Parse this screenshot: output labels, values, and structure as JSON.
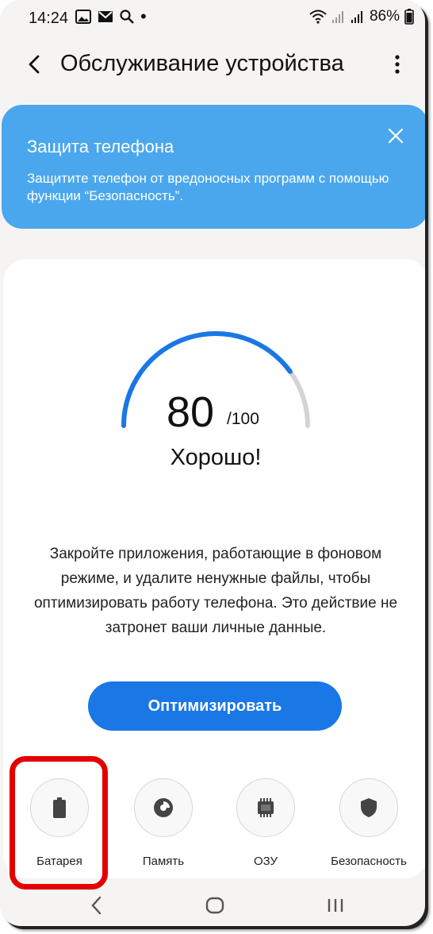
{
  "status_bar": {
    "time": "14:24",
    "battery": "86%"
  },
  "app_bar": {
    "title": "Обслуживание устройства"
  },
  "banner": {
    "title": "Защита телефона",
    "text": "Защитите телефон от вредоносных программ с помощью функции “Безопасность”."
  },
  "score": {
    "value": "80",
    "max": "/100",
    "fraction": 0.8,
    "status": "Хорошо!"
  },
  "description": "Закройте приложения, работающие в фоновом режиме, и удалите ненужные файлы, чтобы оптимизировать работу телефона. Это действие не затронет ваши личные данные.",
  "optimize_label": "Оптимизировать",
  "tools": [
    {
      "label": "Батарея",
      "icon": "battery-icon"
    },
    {
      "label": "Память",
      "icon": "storage-pie-icon"
    },
    {
      "label": "ОЗУ",
      "icon": "memory-chip-icon"
    },
    {
      "label": "Безопасность",
      "icon": "shield-icon"
    }
  ],
  "colors": {
    "accent": "#1977e6",
    "banner": "#4aa7ee",
    "gauge_track": "#d4d4d4",
    "highlight": "#e30000"
  }
}
